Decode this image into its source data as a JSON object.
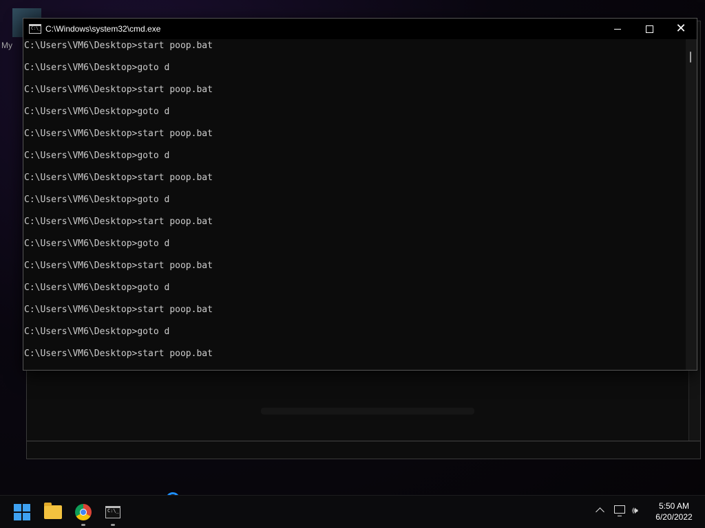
{
  "desktop": {
    "icon_label": "My"
  },
  "cmd_window": {
    "title": "C:\\Windows\\system32\\cmd.exe",
    "title_icon_glyph": "C:\\_",
    "controls": {
      "minimize": "minimize-icon",
      "maximize": "maximize-icon",
      "close": "close-icon"
    },
    "lines": [
      "C:\\Users\\VM6\\Desktop>start poop.bat",
      "C:\\Users\\VM6\\Desktop>goto d",
      "C:\\Users\\VM6\\Desktop>start poop.bat",
      "C:\\Users\\VM6\\Desktop>goto d",
      "C:\\Users\\VM6\\Desktop>start poop.bat",
      "C:\\Users\\VM6\\Desktop>goto d",
      "C:\\Users\\VM6\\Desktop>start poop.bat",
      "C:\\Users\\VM6\\Desktop>goto d",
      "C:\\Users\\VM6\\Desktop>start poop.bat",
      "C:\\Users\\VM6\\Desktop>goto d",
      "C:\\Users\\VM6\\Desktop>start poop.bat",
      "C:\\Users\\VM6\\Desktop>goto d",
      "C:\\Users\\VM6\\Desktop>start poop.bat",
      "C:\\Users\\VM6\\Desktop>goto d",
      "C:\\Users\\VM6\\Desktop>start poop.bat"
    ]
  },
  "taskbar": {
    "apps": [
      {
        "name": "start-button",
        "icon": "windows-logo-icon",
        "running": false
      },
      {
        "name": "file-explorer",
        "icon": "folder-icon",
        "running": false
      },
      {
        "name": "chrome",
        "icon": "chrome-icon",
        "running": true
      },
      {
        "name": "command-prompt",
        "icon": "cmd-icon",
        "running": true
      }
    ],
    "cmd_icon_glyph": "C:\\_",
    "tray": {
      "chevron": "chevron-up-icon",
      "network": "network-icon",
      "volume": "speaker-icon",
      "volume_glyph": "🕪"
    },
    "clock": {
      "time": "5:50 AM",
      "date": "6/20/2022"
    }
  },
  "colors": {
    "console_bg": "#0c0c0c",
    "console_text": "#cccccc",
    "start_blue": "#3ea2f2",
    "spinner_blue": "#1e90ff"
  }
}
